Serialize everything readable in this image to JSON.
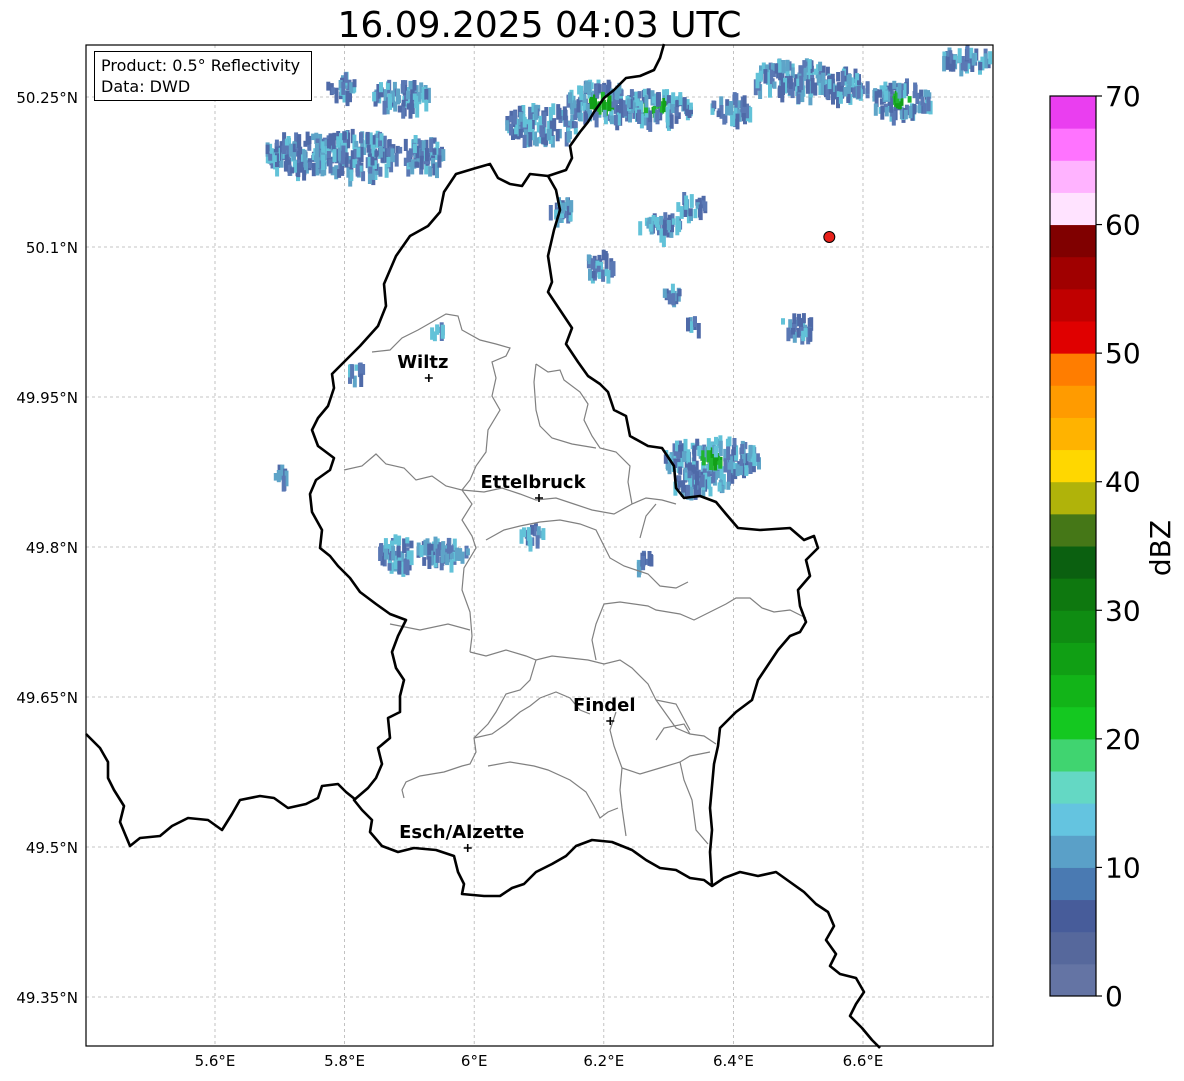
{
  "title": "16.09.2025 04:03 UTC",
  "info": {
    "product": "Product: 0.5° Reflectivity",
    "data": "Data: DWD"
  },
  "map": {
    "lon_ticks": [
      {
        "value": 5.6,
        "label": "5.6°E"
      },
      {
        "value": 5.8,
        "label": "5.8°E"
      },
      {
        "value": 6.0,
        "label": "6°E"
      },
      {
        "value": 6.2,
        "label": "6.2°E"
      },
      {
        "value": 6.4,
        "label": "6.4°E"
      },
      {
        "value": 6.6,
        "label": "6.6°E"
      }
    ],
    "lat_ticks": [
      {
        "value": 50.25,
        "label": "50.25°N"
      },
      {
        "value": 50.1,
        "label": "50.1°N"
      },
      {
        "value": 49.95,
        "label": "49.95°N"
      },
      {
        "value": 49.8,
        "label": "49.8°N"
      },
      {
        "value": 49.65,
        "label": "49.65°N"
      },
      {
        "value": 49.5,
        "label": "49.5°N"
      },
      {
        "value": 49.35,
        "label": "49.35°N"
      }
    ],
    "cities": [
      {
        "name": "Wiltz",
        "lon": 5.93,
        "lat": 49.969
      },
      {
        "name": "Ettelbruck",
        "lon": 6.1,
        "lat": 49.849
      },
      {
        "name": "Findel",
        "lon": 6.21,
        "lat": 49.626
      },
      {
        "name": "Esch/Alzette",
        "lon": 5.99,
        "lat": 49.499
      }
    ],
    "radar_site": {
      "lon": 6.548,
      "lat": 50.11,
      "color": "#e8211b"
    }
  },
  "colorbar": {
    "label": "dBZ",
    "ticks": [
      "0",
      "10",
      "20",
      "30",
      "40",
      "50",
      "60",
      "70"
    ],
    "colors": [
      "#6474a4",
      "#56689c",
      "#475c9a",
      "#4a7ab2",
      "#5aa0c8",
      "#64c4e0",
      "#64d8c4",
      "#40d470",
      "#14c820",
      "#12b418",
      "#109f14",
      "#0f8c12",
      "#0e780f",
      "#0b6010",
      "#457717",
      "#b0b30a",
      "#ffd700",
      "#ffb300",
      "#ff9b00",
      "#ff7d00",
      "#e00000",
      "#c00000",
      "#a00000",
      "#800000",
      "#ffe3ff",
      "#ffb3ff",
      "#ff73ff",
      "#ea3ef0"
    ]
  }
}
